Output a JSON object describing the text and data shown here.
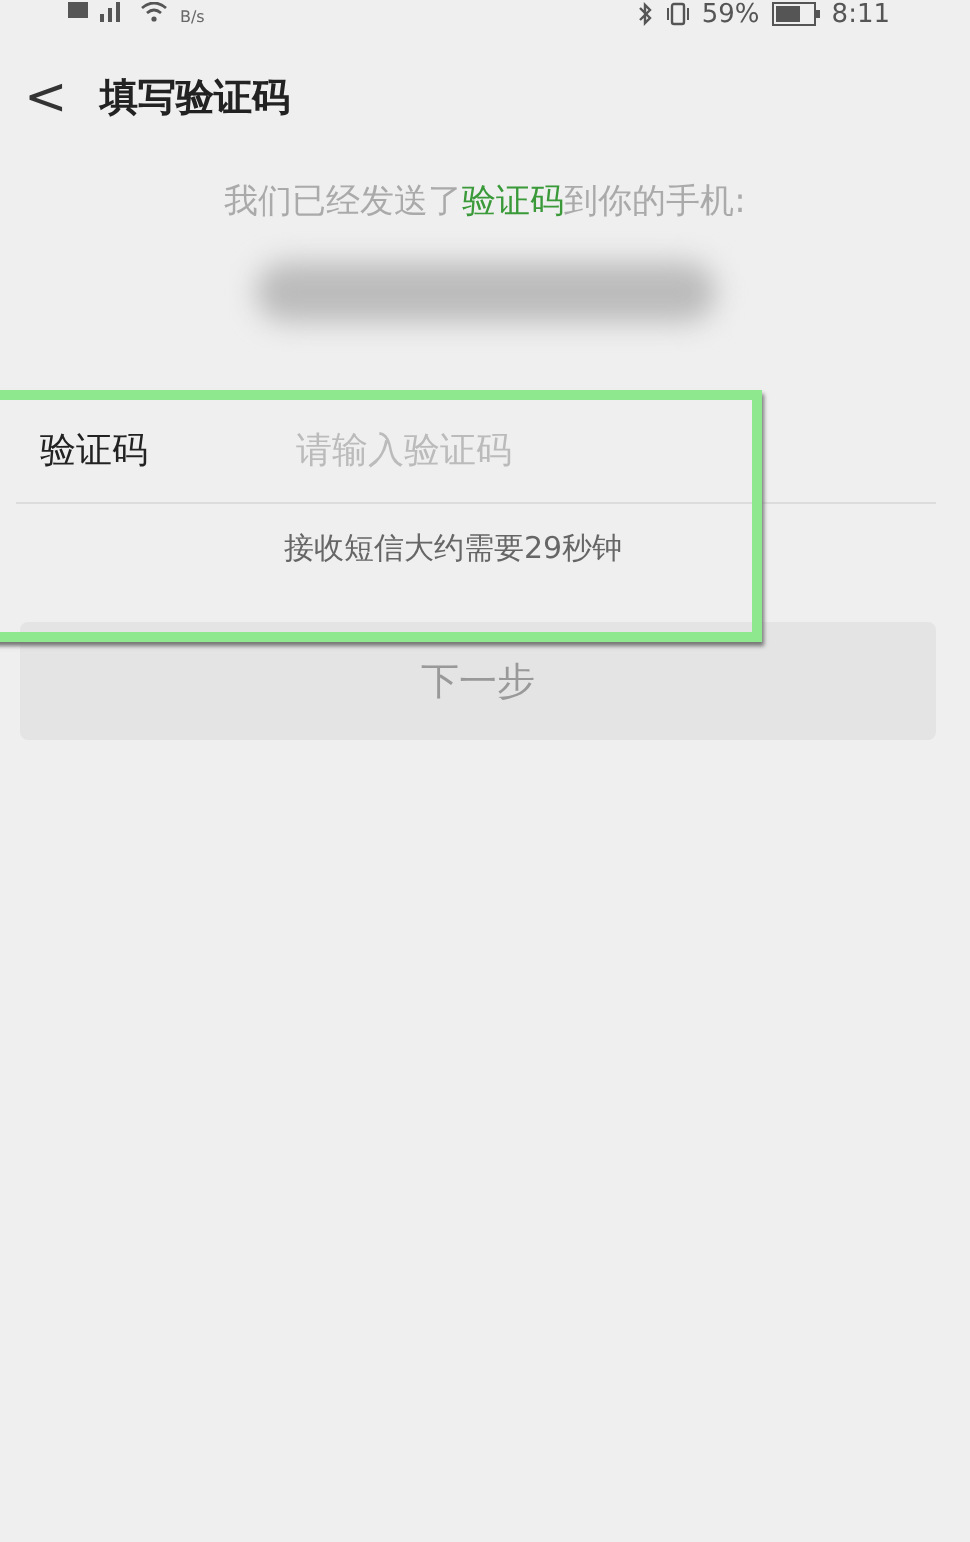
{
  "status_bar": {
    "speed_unit": "B/s",
    "battery": "59%",
    "time": "8:11"
  },
  "header": {
    "back": "<",
    "title": "填写验证码"
  },
  "intro": "我们已经发送了**验证码**到你的手机:",
  "form": {
    "label": "验证码",
    "placeholder": "请输入验证码",
    "hint": "接收短信大约需要29秒钟"
  },
  "next_button": {
    "label": "下一步",
    "disabled": true
  }
}
